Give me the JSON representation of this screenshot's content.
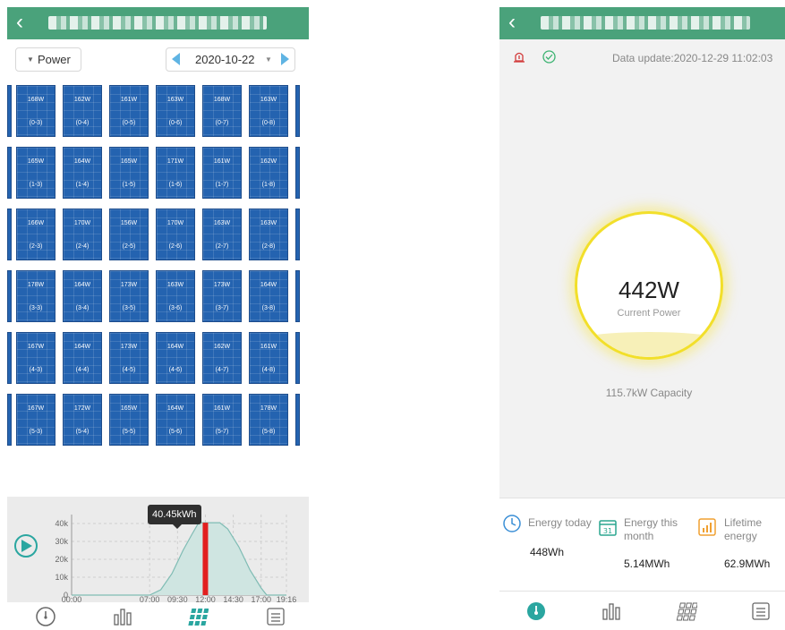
{
  "left": {
    "power_select": "Power",
    "date": "2020-10-22",
    "panels": [
      {
        "power": "168W",
        "pos": "(0-3)"
      },
      {
        "power": "162W",
        "pos": "(0-4)"
      },
      {
        "power": "161W",
        "pos": "(0-5)"
      },
      {
        "power": "163W",
        "pos": "(0-6)"
      },
      {
        "power": "168W",
        "pos": "(0-7)"
      },
      {
        "power": "163W",
        "pos": "(0-8)"
      },
      {
        "power": "165W",
        "pos": "(1-3)"
      },
      {
        "power": "164W",
        "pos": "(1-4)"
      },
      {
        "power": "165W",
        "pos": "(1-5)"
      },
      {
        "power": "171W",
        "pos": "(1-6)"
      },
      {
        "power": "161W",
        "pos": "(1-7)"
      },
      {
        "power": "162W",
        "pos": "(1-8)"
      },
      {
        "power": "166W",
        "pos": "(2-3)"
      },
      {
        "power": "170W",
        "pos": "(2-4)"
      },
      {
        "power": "156W",
        "pos": "(2-5)"
      },
      {
        "power": "170W",
        "pos": "(2-6)"
      },
      {
        "power": "163W",
        "pos": "(2-7)"
      },
      {
        "power": "163W",
        "pos": "(2-8)"
      },
      {
        "power": "178W",
        "pos": "(3-3)"
      },
      {
        "power": "164W",
        "pos": "(3-4)"
      },
      {
        "power": "173W",
        "pos": "(3-5)"
      },
      {
        "power": "163W",
        "pos": "(3-6)"
      },
      {
        "power": "173W",
        "pos": "(3-7)"
      },
      {
        "power": "164W",
        "pos": "(3-8)"
      },
      {
        "power": "167W",
        "pos": "(4-3)"
      },
      {
        "power": "164W",
        "pos": "(4-4)"
      },
      {
        "power": "173W",
        "pos": "(4-5)"
      },
      {
        "power": "164W",
        "pos": "(4-6)"
      },
      {
        "power": "162W",
        "pos": "(4-7)"
      },
      {
        "power": "161W",
        "pos": "(4-8)"
      },
      {
        "power": "167W",
        "pos": "(5-3)"
      },
      {
        "power": "172W",
        "pos": "(5-4)"
      },
      {
        "power": "165W",
        "pos": "(5-5)"
      },
      {
        "power": "164W",
        "pos": "(5-6)"
      },
      {
        "power": "161W",
        "pos": "(5-7)"
      },
      {
        "power": "178W",
        "pos": "(5-8)"
      }
    ],
    "tooltip": "40.45kWh"
  },
  "chart_data": {
    "type": "area",
    "x": [
      "00:00",
      "07:00",
      "09:30",
      "12:00",
      "14:30",
      "17:00",
      "19:16"
    ],
    "x_hours": [
      0,
      7,
      9.5,
      12,
      14.5,
      17,
      19.27
    ],
    "y_ticks": [
      "0",
      "10k",
      "20k",
      "30k",
      "40k"
    ],
    "ylim": [
      0,
      45000
    ],
    "series": [
      {
        "points": [
          [
            0,
            0
          ],
          [
            7,
            0
          ],
          [
            8,
            3000
          ],
          [
            9,
            12000
          ],
          [
            10,
            25000
          ],
          [
            10.8,
            34000
          ],
          [
            11.4,
            40450
          ],
          [
            13.3,
            40450
          ],
          [
            14,
            37000
          ],
          [
            15,
            27000
          ],
          [
            16,
            14000
          ],
          [
            17,
            4000
          ],
          [
            17.5,
            0
          ],
          [
            19.27,
            0
          ]
        ]
      }
    ],
    "highlight_x": 12,
    "grid": true,
    "colors": {
      "fill": "#cfe5e1",
      "line": "#7fbcb4",
      "highlight": "#e21f1f"
    }
  },
  "right": {
    "data_update": "Data update:2020-12-29 11:02:03",
    "current_power": "442W",
    "current_power_label": "Current Power",
    "capacity": "115.7kW Capacity",
    "stats": [
      {
        "label": "Energy today",
        "value": "448Wh"
      },
      {
        "label": "Energy this month",
        "value": "5.14MWh"
      },
      {
        "label": "Lifetime energy",
        "value": "62.9MWh"
      }
    ]
  },
  "icons": {
    "nav_left": [
      "gauge-icon",
      "bar-chart-icon",
      "panel-grid-icon",
      "list-icon"
    ],
    "nav_right": [
      "gauge-icon",
      "bar-chart-icon",
      "panel-grid-icon",
      "list-icon"
    ]
  },
  "colors": {
    "header": "#4aa27b",
    "accent": "#2aa6a0",
    "panel": "#2463b0"
  }
}
